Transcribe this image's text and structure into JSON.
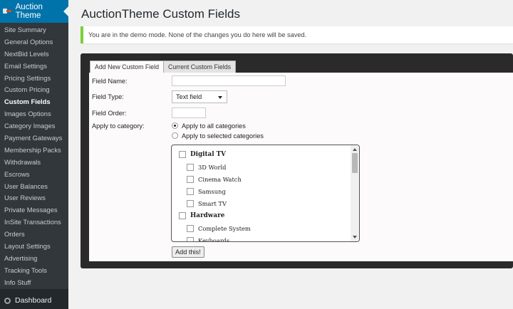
{
  "sidebar": {
    "header": "Auction Theme",
    "items": [
      {
        "label": "Site Summary"
      },
      {
        "label": "General Options"
      },
      {
        "label": "NextBid Levels"
      },
      {
        "label": "Email Settings"
      },
      {
        "label": "Pricing Settings"
      },
      {
        "label": "Custom Pricing"
      },
      {
        "label": "Custom Fields"
      },
      {
        "label": "Images Options"
      },
      {
        "label": "Category Images"
      },
      {
        "label": "Payment Gateways"
      },
      {
        "label": "Membership Packs"
      },
      {
        "label": "Withdrawals"
      },
      {
        "label": "Escrows"
      },
      {
        "label": "User Balances"
      },
      {
        "label": "User Reviews"
      },
      {
        "label": "Private Messages"
      },
      {
        "label": "InSite Transactions"
      },
      {
        "label": "Orders"
      },
      {
        "label": "Layout Settings"
      },
      {
        "label": "Advertising"
      },
      {
        "label": "Tracking Tools"
      },
      {
        "label": "Info Stuff"
      }
    ],
    "active": "Custom Fields",
    "dashboard": "Dashboard"
  },
  "page": {
    "title": "AuctionTheme Custom Fields",
    "notice": "You are in the demo mode. None of the changes you do here will be saved."
  },
  "tabs": [
    {
      "label": "Add New Custom Field",
      "active": true
    },
    {
      "label": "Current Custom Fields",
      "active": false
    }
  ],
  "form": {
    "field_name_label": "Field Name:",
    "field_name_value": "",
    "field_type_label": "Field Type:",
    "field_type_value": "Text field",
    "field_order_label": "Field Order:",
    "field_order_value": "",
    "apply_label": "Apply to category:",
    "radio_all": "Apply to all categories",
    "radio_selected": "Apply to selected categories",
    "radio_checked": "all",
    "categories": [
      {
        "label": "Digital TV",
        "parent": true
      },
      {
        "label": "3D World",
        "parent": false
      },
      {
        "label": "Cinema Watch",
        "parent": false
      },
      {
        "label": "Samsung",
        "parent": false
      },
      {
        "label": "Smart TV",
        "parent": false
      },
      {
        "label": "Hardware",
        "parent": true
      },
      {
        "label": "Complete System",
        "parent": false
      },
      {
        "label": "Keyboards",
        "parent": false
      }
    ],
    "submit": "Add this!"
  },
  "colors": {
    "sidebar_bg": "#32373c",
    "sidebar_header_bg": "#0073aa",
    "notice_border": "#7ad03a",
    "panel_bg": "#2a2a2a"
  }
}
